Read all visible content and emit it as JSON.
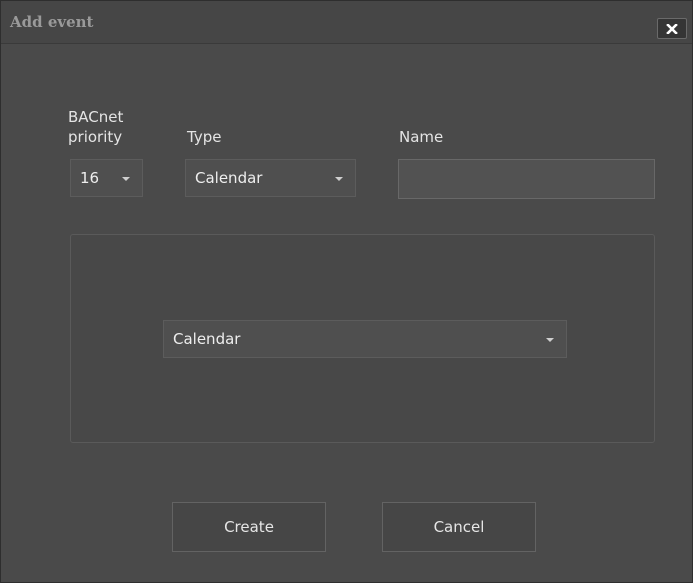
{
  "dialog": {
    "title": "Add event",
    "close_icon": "close-x-icon"
  },
  "form": {
    "priority_label_line1": "BACnet",
    "priority_label_line2": "priority",
    "priority_value": "16",
    "type_label": "Type",
    "type_value": "Calendar",
    "name_label": "Name",
    "name_value": "",
    "calendar_value": "Calendar"
  },
  "buttons": {
    "create": "Create",
    "cancel": "Cancel"
  }
}
